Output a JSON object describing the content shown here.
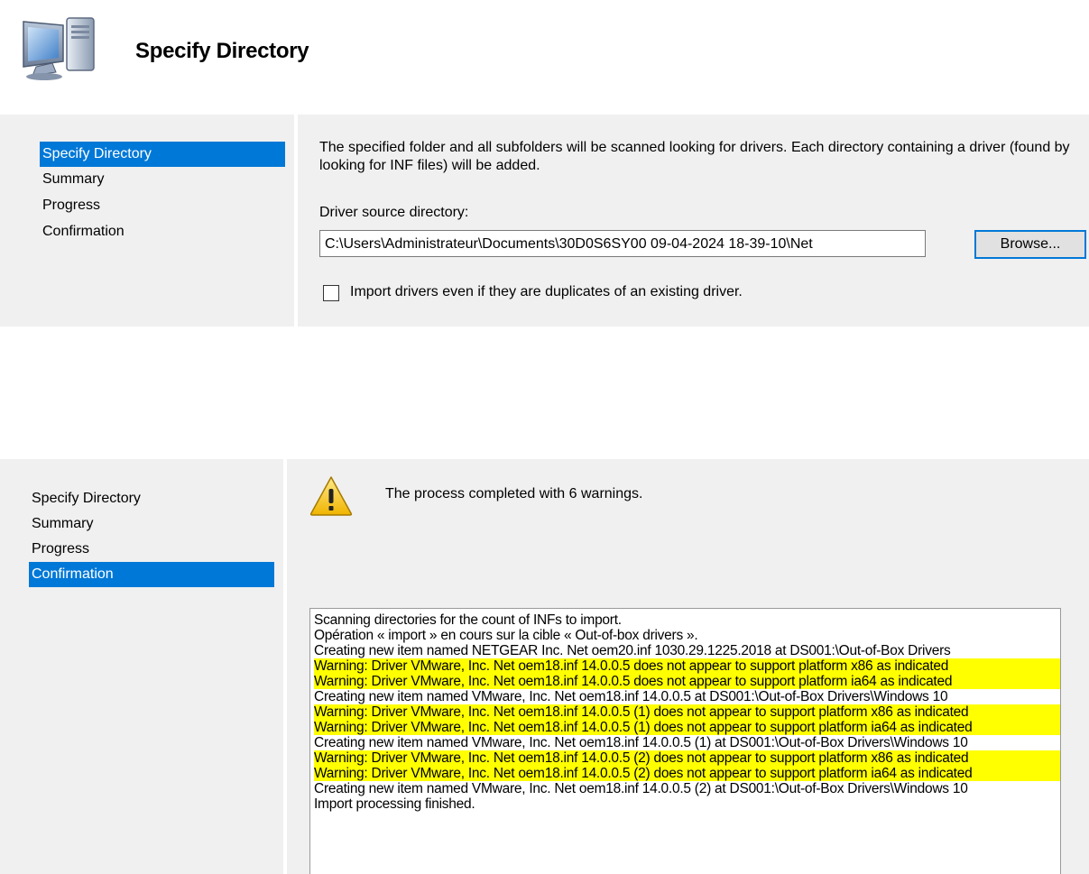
{
  "header": {
    "title": "Specify Directory",
    "icon": "computer-icon"
  },
  "wizard1": {
    "nav": [
      {
        "label": "Specify Directory",
        "selected": true
      },
      {
        "label": "Summary",
        "selected": false
      },
      {
        "label": "Progress",
        "selected": false
      },
      {
        "label": "Confirmation",
        "selected": false
      }
    ],
    "description": "The specified folder and all subfolders will be scanned looking for drivers.  Each directory containing a driver (found by looking for INF files) will be added.",
    "source_label": "Driver source directory:",
    "source_value": "C:\\Users\\Administrateur\\Documents\\30D0S6SY00 09-04-2024 18-39-10\\Net",
    "browse_label": "Browse...",
    "checkbox_label": "Import drivers even if they are duplicates of an existing driver.",
    "checkbox_checked": false
  },
  "wizard2": {
    "nav": [
      {
        "label": "Specify Directory",
        "selected": false
      },
      {
        "label": "Summary",
        "selected": false
      },
      {
        "label": "Progress",
        "selected": false
      },
      {
        "label": "Confirmation",
        "selected": true
      }
    ],
    "status_icon": "warning-icon",
    "status_text": "The process completed with 6 warnings.",
    "log": [
      {
        "text": "Scanning directories for the count of INFs to import.",
        "warning": false
      },
      {
        "text": "Opération « import » en cours sur la cible « Out-of-box drivers ».",
        "warning": false
      },
      {
        "text": "Creating new item named NETGEAR Inc. Net oem20.inf 1030.29.1225.2018 at DS001:\\Out-of-Box Drivers",
        "warning": false
      },
      {
        "text": "Warning: Driver VMware, Inc. Net oem18.inf 14.0.0.5 does not appear to support platform x86 as indicated",
        "warning": true
      },
      {
        "text": "Warning: Driver VMware, Inc. Net oem18.inf 14.0.0.5 does not appear to support platform ia64 as indicated",
        "warning": true
      },
      {
        "text": "Creating new item named VMware, Inc. Net oem18.inf 14.0.0.5 at DS001:\\Out-of-Box Drivers\\Windows 10",
        "warning": false
      },
      {
        "text": "Warning: Driver VMware, Inc. Net oem18.inf 14.0.0.5 (1) does not appear to support platform x86 as indicated",
        "warning": true
      },
      {
        "text": "Warning: Driver VMware, Inc. Net oem18.inf 14.0.0.5 (1) does not appear to support platform ia64 as indicated",
        "warning": true
      },
      {
        "text": "Creating new item named VMware, Inc. Net oem18.inf 14.0.0.5 (1) at DS001:\\Out-of-Box Drivers\\Windows 10",
        "warning": false
      },
      {
        "text": "Warning: Driver VMware, Inc. Net oem18.inf 14.0.0.5 (2) does not appear to support platform x86 as indicated",
        "warning": true
      },
      {
        "text": "Warning: Driver VMware, Inc. Net oem18.inf 14.0.0.5 (2) does not appear to support platform ia64 as indicated",
        "warning": true
      },
      {
        "text": "Creating new item named VMware, Inc. Net oem18.inf 14.0.0.5 (2) at DS001:\\Out-of-Box Drivers\\Windows 10",
        "warning": false
      },
      {
        "text": "Import processing finished.",
        "warning": false
      }
    ]
  },
  "colors": {
    "selection": "#0078d7",
    "panel_bg": "#f0f0f0",
    "warning_highlight": "#ffff00"
  }
}
